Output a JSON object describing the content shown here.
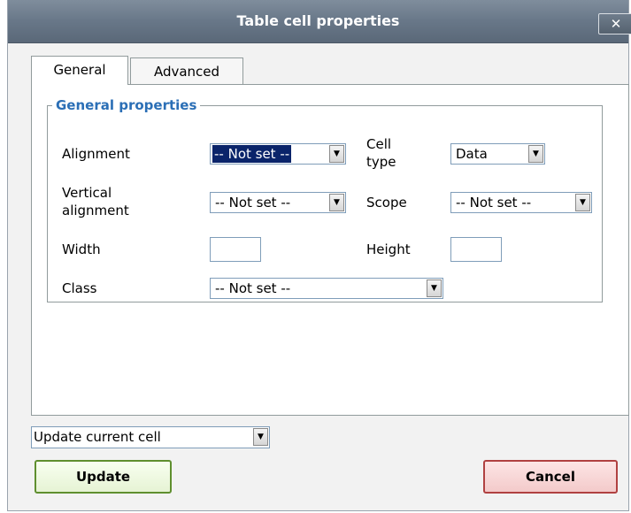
{
  "dialog": {
    "title": "Table cell properties",
    "close_label": "✕"
  },
  "tabs": [
    {
      "label": "General",
      "active": true
    },
    {
      "label": "Advanced",
      "active": false
    }
  ],
  "general": {
    "legend": "General properties",
    "alignment_label": "Alignment",
    "alignment_value": "-- Not set --",
    "cell_type_label_1": "Cell",
    "cell_type_label_2": "type",
    "cell_type_value": "Data",
    "vertical_alignment_label_1": "Vertical",
    "vertical_alignment_label_2": "alignment",
    "vertical_alignment_value": "-- Not set --",
    "scope_label": "Scope",
    "scope_value": "-- Not set --",
    "width_label": "Width",
    "width_value": "",
    "height_label": "Height",
    "height_value": "",
    "class_label": "Class",
    "class_value": "-- Not set --"
  },
  "action_select": {
    "value": "Update current cell"
  },
  "buttons": {
    "update": "Update",
    "cancel": "Cancel"
  }
}
